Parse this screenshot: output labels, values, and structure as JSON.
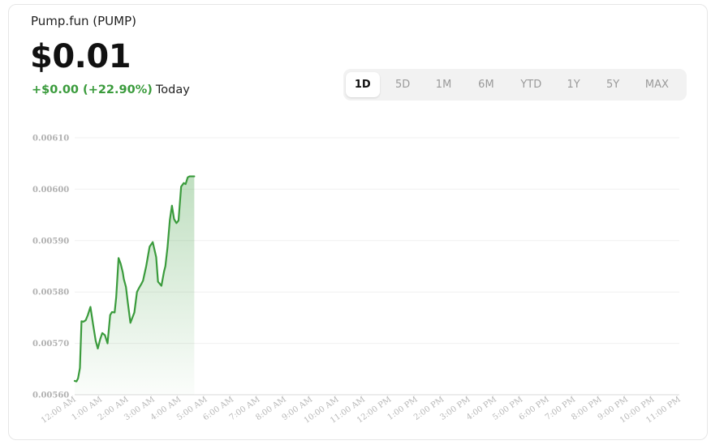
{
  "header": {
    "asset_name": "Pump.fun (PUMP)",
    "price": "$0.01",
    "change": "+$0.00 (+22.90%)",
    "period": "Today"
  },
  "range_selector": {
    "options": [
      "1D",
      "5D",
      "1M",
      "6M",
      "YTD",
      "1Y",
      "5Y",
      "MAX"
    ],
    "selected": "1D"
  },
  "colors": {
    "line": "#3a9b3c",
    "positive_text": "#3a9b3c"
  },
  "chart_data": {
    "type": "area",
    "title": "",
    "xlabel": "",
    "ylabel": "",
    "x_unit": "hour_of_day",
    "ylim": [
      0.0056,
      0.0061
    ],
    "xlim": [
      0,
      23
    ],
    "yticks": [
      0.0056,
      0.0057,
      0.0058,
      0.0059,
      0.006,
      0.0061
    ],
    "ytick_labels": [
      "0.00560",
      "0.00570",
      "0.00580",
      "0.00590",
      "0.00600",
      "0.00610"
    ],
    "xtick_labels": [
      "12:00 AM",
      "1:00 AM",
      "2:00 AM",
      "3:00 AM",
      "4:00 AM",
      "5:00 AM",
      "6:00 AM",
      "7:00 AM",
      "8:00 AM",
      "9:00 AM",
      "10:00 AM",
      "11:00 AM",
      "12:00 PM",
      "1:00 PM",
      "2:00 PM",
      "3:00 PM",
      "4:00 PM",
      "5:00 PM",
      "6:00 PM",
      "7:00 PM",
      "8:00 PM",
      "9:00 PM",
      "10:00 PM",
      "11:00 PM"
    ],
    "grid": true,
    "series": [
      {
        "x": [
          0.0,
          0.07,
          0.13,
          0.2,
          0.26,
          0.33,
          0.42,
          0.5,
          0.6,
          0.7,
          0.8,
          0.88,
          0.97,
          1.05,
          1.15,
          1.25,
          1.35,
          1.42,
          1.52,
          1.58,
          1.67,
          1.75,
          1.83,
          1.87,
          1.95,
          2.02,
          2.12,
          2.27,
          2.37,
          2.45,
          2.53,
          2.6,
          2.72,
          2.85,
          2.97,
          3.1,
          3.17,
          3.3,
          3.4,
          3.45,
          3.53,
          3.62,
          3.7,
          3.78,
          3.87,
          3.95,
          4.05,
          4.15,
          4.22,
          4.3,
          4.37,
          4.45,
          4.5,
          4.55
        ],
        "y": [
          0.005627,
          0.005626,
          0.005632,
          0.005652,
          0.005743,
          0.005742,
          0.005745,
          0.005755,
          0.005771,
          0.005737,
          0.005705,
          0.00569,
          0.005708,
          0.00572,
          0.005716,
          0.0057,
          0.005755,
          0.005761,
          0.00576,
          0.00579,
          0.005866,
          0.005855,
          0.005838,
          0.005825,
          0.00581,
          0.00578,
          0.00574,
          0.00576,
          0.0058,
          0.005808,
          0.005815,
          0.005822,
          0.00585,
          0.005888,
          0.005897,
          0.005868,
          0.00582,
          0.005812,
          0.00584,
          0.00585,
          0.005886,
          0.00594,
          0.005968,
          0.005942,
          0.005934,
          0.005939,
          0.006005,
          0.006012,
          0.00601,
          0.006023,
          0.006025,
          0.006025,
          0.006025,
          0.006025
        ]
      }
    ]
  }
}
